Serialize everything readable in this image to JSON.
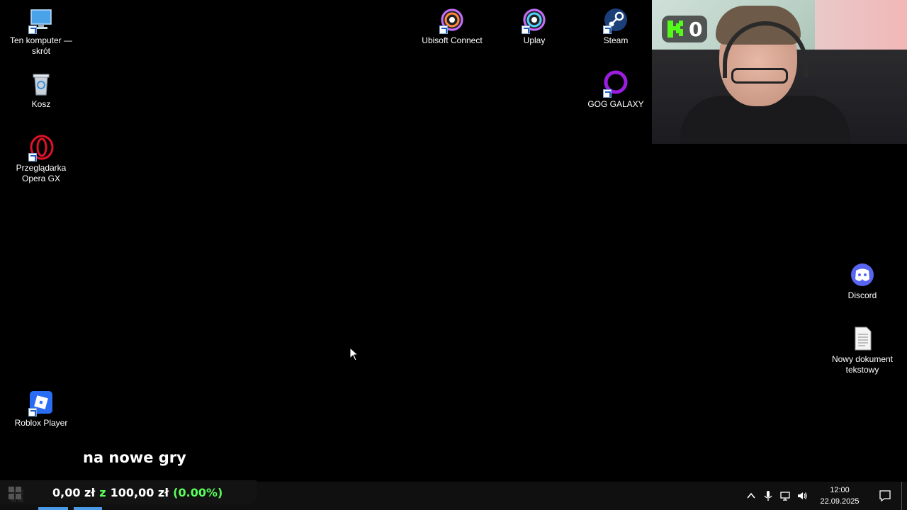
{
  "desktop_icons": {
    "this_pc": {
      "label": "Ten komputer — skrót",
      "icon": "computer-icon"
    },
    "recycle_bin": {
      "label": "Kosz",
      "icon": "recycle-bin-icon"
    },
    "opera_gx": {
      "label": "Przeglądarka Opera GX",
      "icon": "opera-gx-icon"
    },
    "roblox": {
      "label": "Roblox Player",
      "icon": "roblox-icon"
    },
    "ubisoft": {
      "label": "Ubisoft Connect",
      "icon": "ubisoft-icon"
    },
    "uplay": {
      "label": "Uplay",
      "icon": "ubisoft-icon"
    },
    "steam": {
      "label": "Steam",
      "icon": "steam-icon"
    },
    "gog": {
      "label": "GOG GALAXY",
      "icon": "gog-galaxy-icon"
    },
    "discord": {
      "label": "Discord",
      "icon": "discord-icon"
    },
    "text_doc": {
      "label": "Nowy dokument tekstowy",
      "icon": "text-document-icon"
    }
  },
  "overlay": {
    "kick_count": "0",
    "caption": "na nowe gry",
    "donation": {
      "current": "0,00 zł",
      "of": "z",
      "goal": "100,00 zł",
      "percent": "(0.00%)"
    },
    "colors": {
      "goal_green": "#5bff5b",
      "kick_green": "#53fc18"
    }
  },
  "taskbar": {
    "time": "12:00",
    "date": "22.09.2025",
    "tray_icons": [
      "chevron-up-icon",
      "microphone-icon",
      "network-icon",
      "volume-icon"
    ],
    "accent": "#4c9be8"
  }
}
